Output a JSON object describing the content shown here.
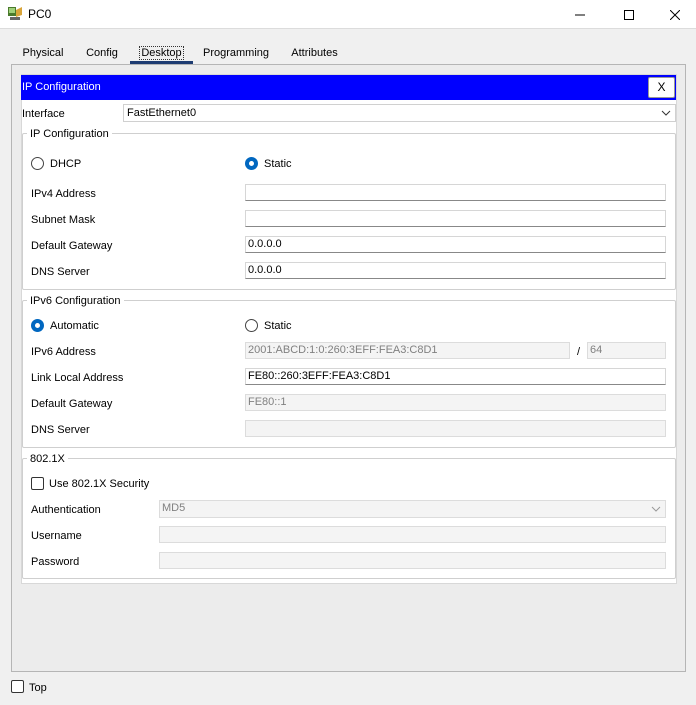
{
  "window": {
    "title": "PC0"
  },
  "tabs": [
    "Physical",
    "Config",
    "Desktop",
    "Programming",
    "Attributes"
  ],
  "ip_config": {
    "header_title": "IP Configuration",
    "close_label": "X",
    "interface_label": "Interface",
    "interface_value": "FastEthernet0",
    "ipv4": {
      "group_title": "IP Configuration",
      "dhcp_label": "DHCP",
      "static_label": "Static",
      "ipv4_address_label": "IPv4 Address",
      "ipv4_address_value": "",
      "subnet_mask_label": "Subnet Mask",
      "subnet_mask_value": "",
      "default_gateway_label": "Default Gateway",
      "default_gateway_value": "0.0.0.0",
      "dns_server_label": "DNS Server",
      "dns_server_value": "0.0.0.0"
    },
    "ipv6": {
      "group_title": "IPv6 Configuration",
      "automatic_label": "Automatic",
      "static_label": "Static",
      "ipv6_address_label": "IPv6 Address",
      "ipv6_address_value": "2001:ABCD:1:0:260:3EFF:FEA3:C8D1",
      "prefix_separator": "/",
      "prefix_value": "64",
      "link_local_label": "Link Local Address",
      "link_local_value": "FE80::260:3EFF:FEA3:C8D1",
      "default_gateway_label": "Default Gateway",
      "default_gateway_value": "FE80::1",
      "dns_server_label": "DNS Server",
      "dns_server_value": ""
    },
    "dot1x": {
      "group_title": "802.1X",
      "use_security_label": "Use 802.1X Security",
      "authentication_label": "Authentication",
      "authentication_value": "MD5",
      "username_label": "Username",
      "username_value": "",
      "password_label": "Password",
      "password_value": ""
    }
  },
  "footer": {
    "top_label": "Top"
  },
  "colors": {
    "header_bar": "#0000ff",
    "radio_selected": "#0067c0",
    "active_tab_underline": "#1e3c72"
  }
}
